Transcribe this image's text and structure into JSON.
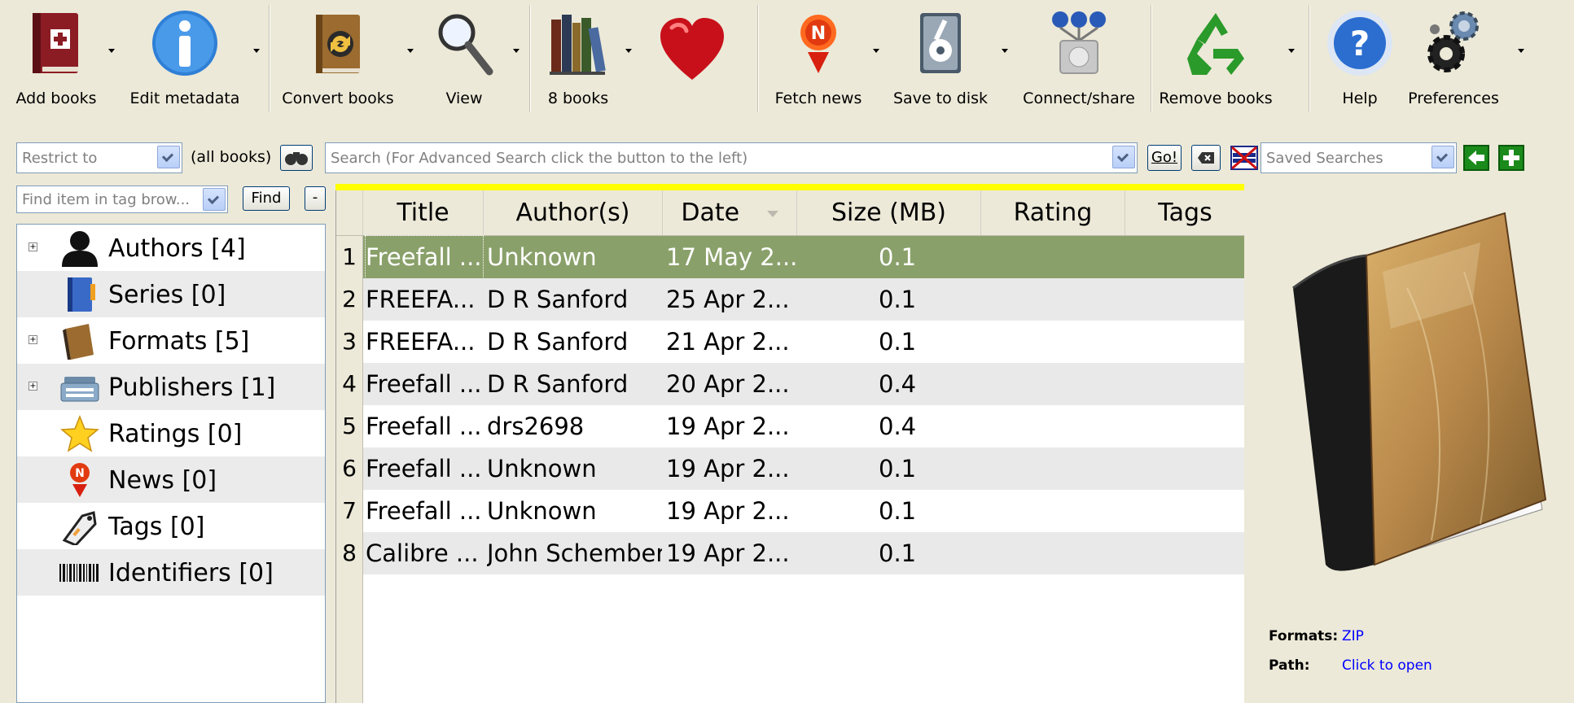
{
  "toolbar": {
    "buttons": [
      {
        "label": "Add books"
      },
      {
        "label": "Edit metadata"
      },
      {
        "label": "Convert books"
      },
      {
        "label": "View"
      },
      {
        "label": "8 books"
      },
      {
        "label": ""
      },
      {
        "label": "Fetch news"
      },
      {
        "label": "Save to disk"
      },
      {
        "label": "Connect/share"
      },
      {
        "label": "Remove books"
      },
      {
        "label": "Help"
      },
      {
        "label": "Preferences"
      }
    ]
  },
  "searchbar": {
    "restrict_placeholder": "Restrict to",
    "restrict_value": "(all books)",
    "search_placeholder": "Search (For Advanced Search click the button to the left)",
    "go_label": "Go!",
    "saved_searches_placeholder": "Saved Searches"
  },
  "tag_browser": {
    "find_placeholder": "Find item in tag brow...",
    "find_label": "Find",
    "collapse_label": "-",
    "items": [
      {
        "label": "Authors [4]",
        "icon": "person-icon",
        "expandable": true
      },
      {
        "label": "Series [0]",
        "icon": "series-icon",
        "expandable": false
      },
      {
        "label": "Formats [5]",
        "icon": "book-icon",
        "expandable": true
      },
      {
        "label": "Publishers [1]",
        "icon": "typewriter-icon",
        "expandable": true
      },
      {
        "label": "Ratings [0]",
        "icon": "star-icon",
        "expandable": false
      },
      {
        "label": "News [0]",
        "icon": "news-icon",
        "expandable": false
      },
      {
        "label": "Tags [0]",
        "icon": "tag-icon",
        "expandable": false
      },
      {
        "label": "Identifiers [0]",
        "icon": "barcode-icon",
        "expandable": false
      }
    ]
  },
  "book_table": {
    "columns": [
      "Title",
      "Author(s)",
      "Date",
      "Size (MB)",
      "Rating",
      "Tags"
    ],
    "rows": [
      {
        "num": "1",
        "title": "Freefall ...",
        "author": "Unknown",
        "date": "17 May 2...",
        "size": "0.1",
        "rating": "",
        "tags": ""
      },
      {
        "num": "2",
        "title": "FREEFA...",
        "author": "D R Sanford",
        "date": "25 Apr 2...",
        "size": "0.1",
        "rating": "",
        "tags": ""
      },
      {
        "num": "3",
        "title": "FREEFA...",
        "author": "D R Sanford",
        "date": "21 Apr 2...",
        "size": "0.1",
        "rating": "",
        "tags": ""
      },
      {
        "num": "4",
        "title": "Freefall ...",
        "author": "D R Sanford",
        "date": "20 Apr 2...",
        "size": "0.4",
        "rating": "",
        "tags": ""
      },
      {
        "num": "5",
        "title": "Freefall ...",
        "author": "drs2698",
        "date": "19 Apr 2...",
        "size": "0.4",
        "rating": "",
        "tags": ""
      },
      {
        "num": "6",
        "title": "Freefall ...",
        "author": "Unknown",
        "date": "19 Apr 2...",
        "size": "0.1",
        "rating": "",
        "tags": ""
      },
      {
        "num": "7",
        "title": "Freefall ...",
        "author": "Unknown",
        "date": "19 Apr 2...",
        "size": "0.1",
        "rating": "",
        "tags": ""
      },
      {
        "num": "8",
        "title": "Calibre ...",
        "author": "John Schember",
        "date": "19 Apr 2...",
        "size": "0.1",
        "rating": "",
        "tags": ""
      }
    ]
  },
  "details": {
    "formats_key": "Formats:",
    "formats_value": "ZIP",
    "path_key": "Path:",
    "path_value": "Click to open"
  },
  "colors": {
    "selected_row": "#8aa06a",
    "accent_bar": "#ffff00",
    "link": "#0000ff"
  }
}
